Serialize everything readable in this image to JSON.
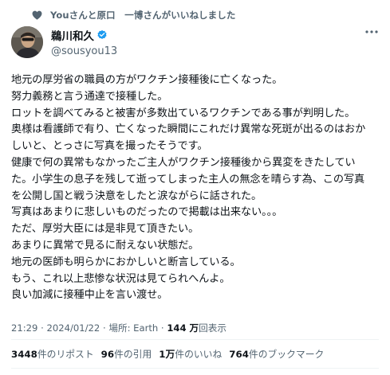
{
  "social_context": {
    "text": "Youさんと原口　一博さんがいいねしました",
    "icon": "heart-icon"
  },
  "author": {
    "display_name": "鵜川和久",
    "handle": "@sousyou13",
    "verified_color": "#1d9bf0"
  },
  "tweet_lines": [
    "地元の厚労省の職員の方がワクチン接種後に亡くなった。",
    "努力義務と言う通達で接種した。",
    "ロットを調べてみると被害が多数出ているワクチンである事が判明した。",
    "奥様は看護師で有り、亡くなった瞬間にこれだけ異常な死斑が出るのはおか",
    "しいと、とっさに写真を撮ったそうです。",
    "健康で何の異常もなかったご主人がワクチン接種後から異変をきたしてい",
    "た。小学生の息子を残して逝ってしまった主人の無念を晴らす為、この写真",
    "を公開し国と戦う決意をしたと涙ながらに話された。",
    "写真はあまりに悲しいものだったので掲載は出来ない。。。",
    "ただ、厚労大臣には是非見て頂きたい。",
    "あまりに異常で見るに耐えない状態だ。",
    "地元の医師も明らかにおかしいと断言している。",
    "もう、これ以上悲惨な状況は見てられへんよ。",
    "良い加減に接種中止を言い渡せ。"
  ],
  "meta": {
    "time": "21:29",
    "sep1": " · ",
    "date": "2024/01/22",
    "sep2": " · ",
    "location": "場所: Earth",
    "sep3": " · ",
    "views_count": "144 万",
    "views_label": "回表示"
  },
  "stats": {
    "reposts": {
      "count": "3448",
      "label": "件のリポスト"
    },
    "quotes": {
      "count": "96",
      "label": "件の引用"
    },
    "likes": {
      "count": "1万",
      "label": "件のいいね"
    },
    "bookmarks": {
      "count": "764",
      "label": "件のブックマーク"
    }
  }
}
